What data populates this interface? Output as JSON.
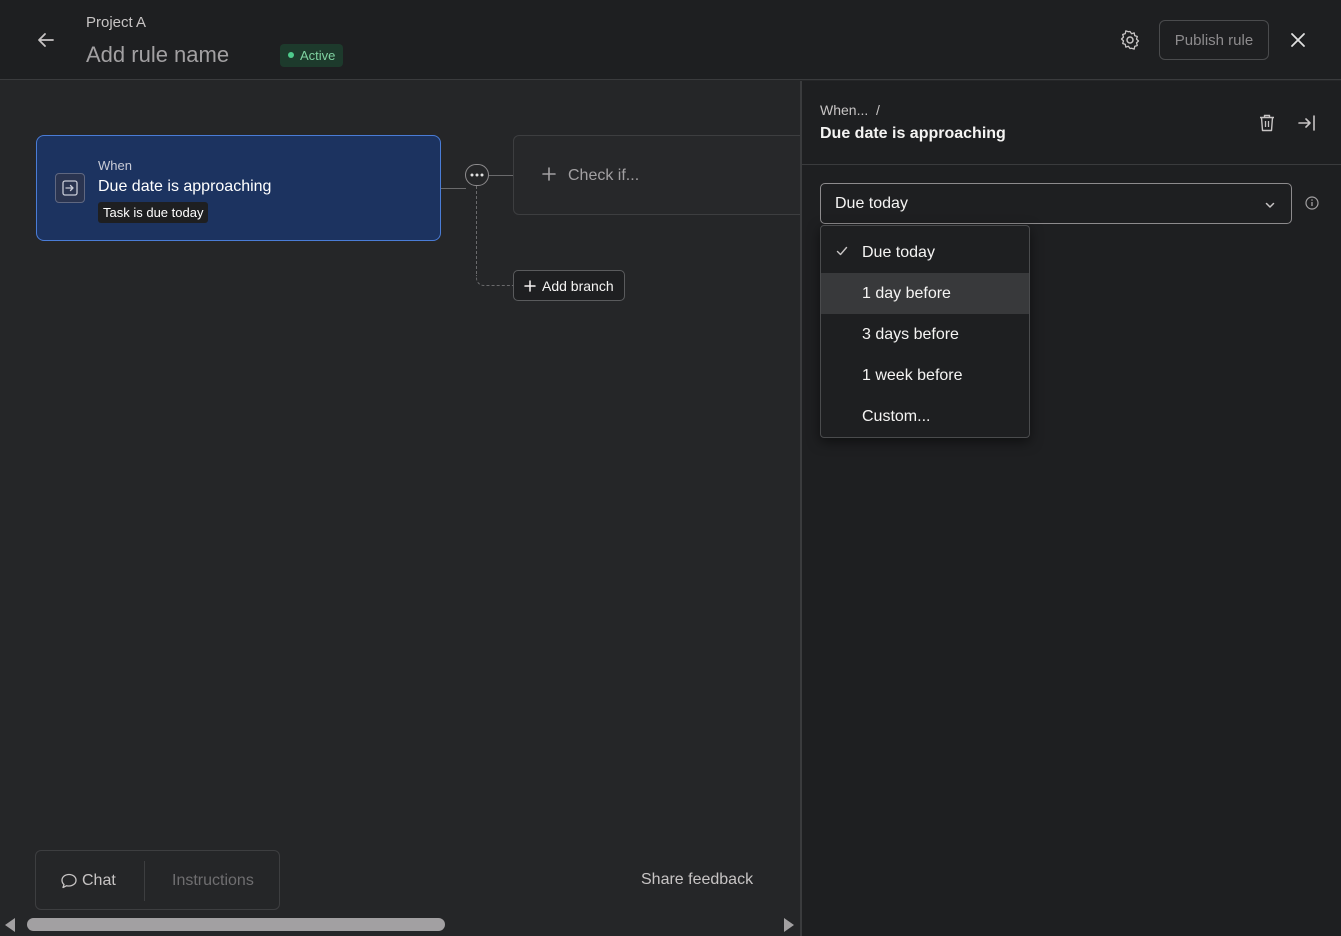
{
  "header": {
    "project": "Project A",
    "rule_name": "Add rule name",
    "status": "Active",
    "publish_label": "Publish rule"
  },
  "canvas": {
    "trigger": {
      "when": "When",
      "title": "Due date is approaching",
      "chip": "Task is due today"
    },
    "check_if": "Check if...",
    "add_branch": "Add branch"
  },
  "bottom": {
    "chat": "Chat",
    "instructions": "Instructions",
    "share_feedback": "Share feedback"
  },
  "panel": {
    "breadcrumb": "When...  /",
    "title": "Due date is approaching",
    "select_value": "Due today",
    "options": [
      "Due today",
      "1 day before",
      "3 days before",
      "1 week before",
      "Custom..."
    ]
  },
  "colors": {
    "accent_blue": "#4a7cd6",
    "active_green": "#4ecb8c"
  }
}
